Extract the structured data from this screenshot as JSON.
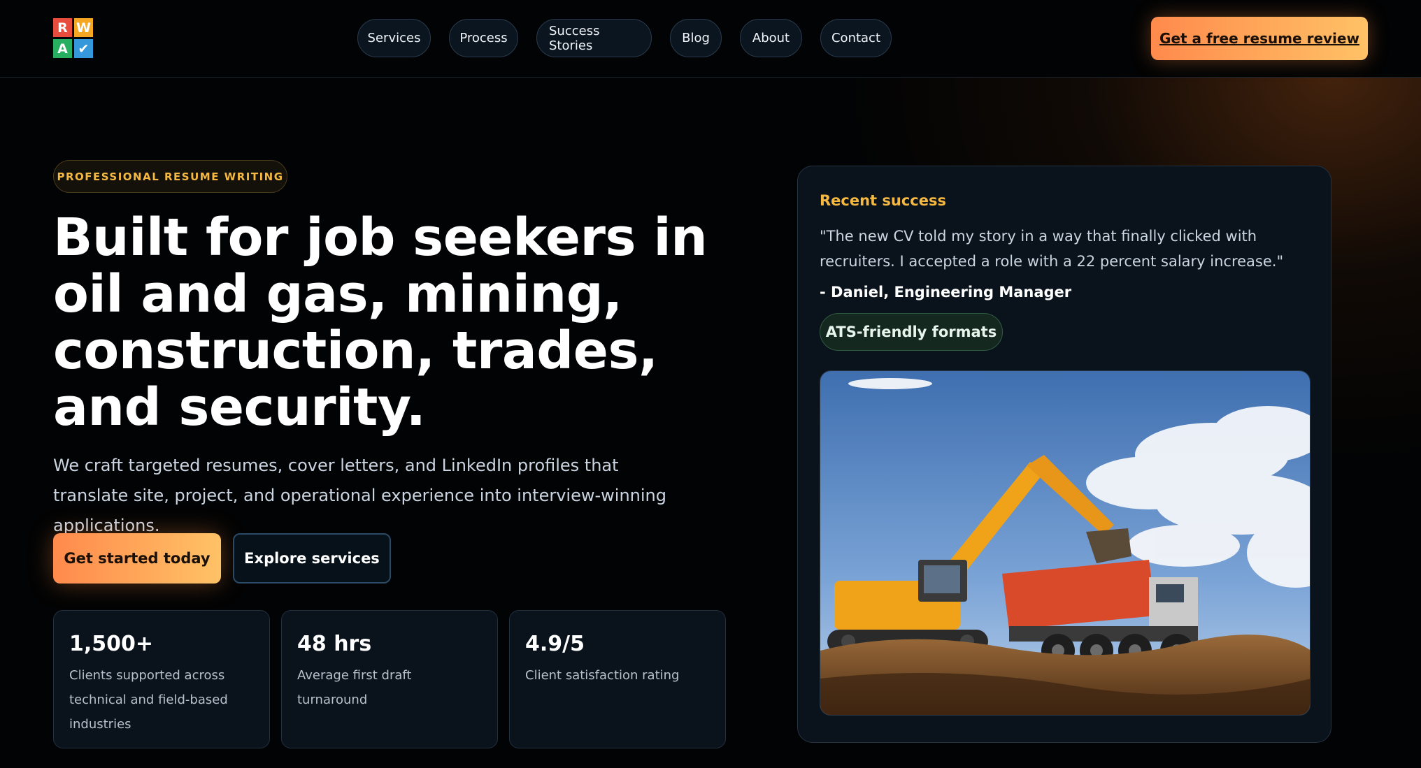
{
  "header": {
    "logo_letters": [
      "R",
      "W",
      "A",
      "✔"
    ],
    "logo_colors": [
      "#e74c3c",
      "#f5a623",
      "#27ae60",
      "#3498db"
    ],
    "nav": [
      "Services",
      "Process",
      "Success Stories",
      "Blog",
      "About",
      "Contact"
    ],
    "cta": "Get a free resume review"
  },
  "hero": {
    "eyebrow": "PROFESSIONAL RESUME WRITING",
    "title": "Built for job seekers in oil and gas, mining, construction, trades, and security.",
    "subtitle": "We craft targeted resumes, cover letters, and LinkedIn profiles that translate site, project, and operational experience into interview-winning applications.",
    "primary_button": "Get started today",
    "secondary_button": "Explore services",
    "stats": [
      {
        "value": "1,500+",
        "label": "Clients supported across technical and field-based industries"
      },
      {
        "value": "48 hrs",
        "label": "Average first draft turnaround"
      },
      {
        "value": "4.9/5",
        "label": "Client satisfaction rating"
      }
    ]
  },
  "success_card": {
    "title": "Recent success",
    "quote": "\"The new CV told my story in a way that finally clicked with recruiters. I accepted a role with a 22 percent salary increase.\"",
    "author": "- Daniel, Engineering Manager",
    "badge": "ATS-friendly formats",
    "image_icon": "excavator-photo"
  },
  "colors": {
    "accent_orange": "#ff8a4c",
    "accent_yellow": "#ffc266",
    "gold_text": "#f5b942",
    "background": "#020304"
  }
}
